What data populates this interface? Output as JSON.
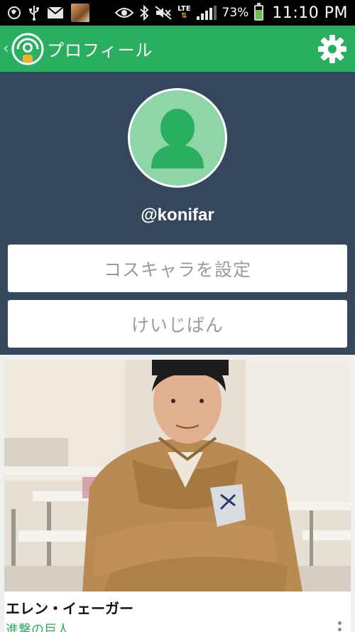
{
  "status_bar": {
    "network_label": "LTE",
    "battery_percent": "73%",
    "battery_level": 0.73,
    "time": "11:10 PM",
    "icons": [
      "globe-icon",
      "usb-icon",
      "mail-icon",
      "notification-thumbnail",
      "eye-icon",
      "bluetooth-icon",
      "mute-icon",
      "lte-icon",
      "signal-icon",
      "battery-charging-icon"
    ]
  },
  "action_bar": {
    "title": "プロフィール",
    "back_icon": "chevron-left-icon",
    "logo_icon": "app-logo-icon",
    "settings_icon": "gear-icon",
    "color": "#2aae60"
  },
  "profile": {
    "username": "@konifar",
    "avatar_icon": "person-icon",
    "panel_color": "#34475c",
    "avatar_bg": "#8ed6a8",
    "buttons": {
      "cosplay_label": "コスキャラを設定",
      "board_label": "けいじばん"
    }
  },
  "feed": {
    "cards": [
      {
        "title": "エレン・イェーガー",
        "subtitle": "進撃の巨人",
        "menu_icon": "more-vert-icon"
      }
    ]
  }
}
